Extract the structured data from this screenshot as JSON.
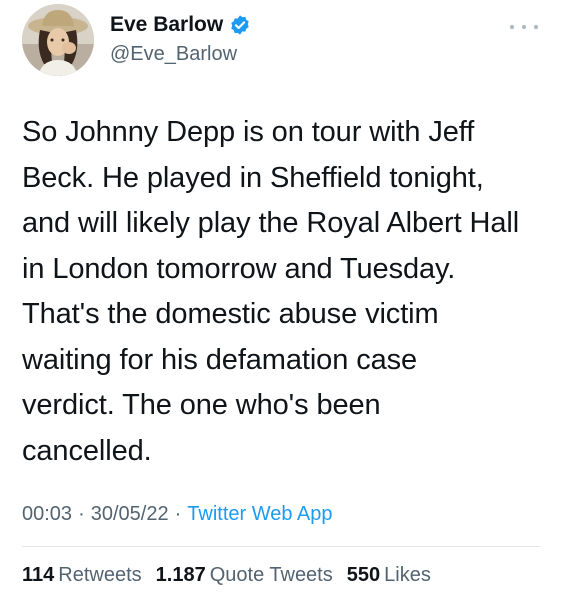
{
  "author": {
    "display_name": "Eve Barlow",
    "handle": "@Eve_Barlow",
    "verified": true,
    "avatar_icon": "profile-photo",
    "verified_icon": "verified-badge-icon",
    "more_icon": "more-options-icon"
  },
  "tweet": {
    "text": "So Johnny Depp is on tour with Jeff\nBeck. He played in Sheffield tonight,\nand will likely play the Royal Albert Hall\nin London tomorrow and Tuesday.\nThat's the domestic abuse victim\nwaiting for his defamation case\nverdict. The one who's been\ncancelled."
  },
  "meta": {
    "time": "00:03",
    "separator": "·",
    "date": "30/05/22",
    "source": "Twitter Web App"
  },
  "stats": {
    "retweets_count": "114",
    "retweets_label": "Retweets",
    "quote_tweets_count": "1.187",
    "quote_tweets_label": "Quote Tweets",
    "likes_count": "550",
    "likes_label": "Likes"
  },
  "colors": {
    "text": "#0f1419",
    "secondary": "#536471",
    "accent": "#1d9bf0",
    "divider": "#e3e7ea"
  }
}
